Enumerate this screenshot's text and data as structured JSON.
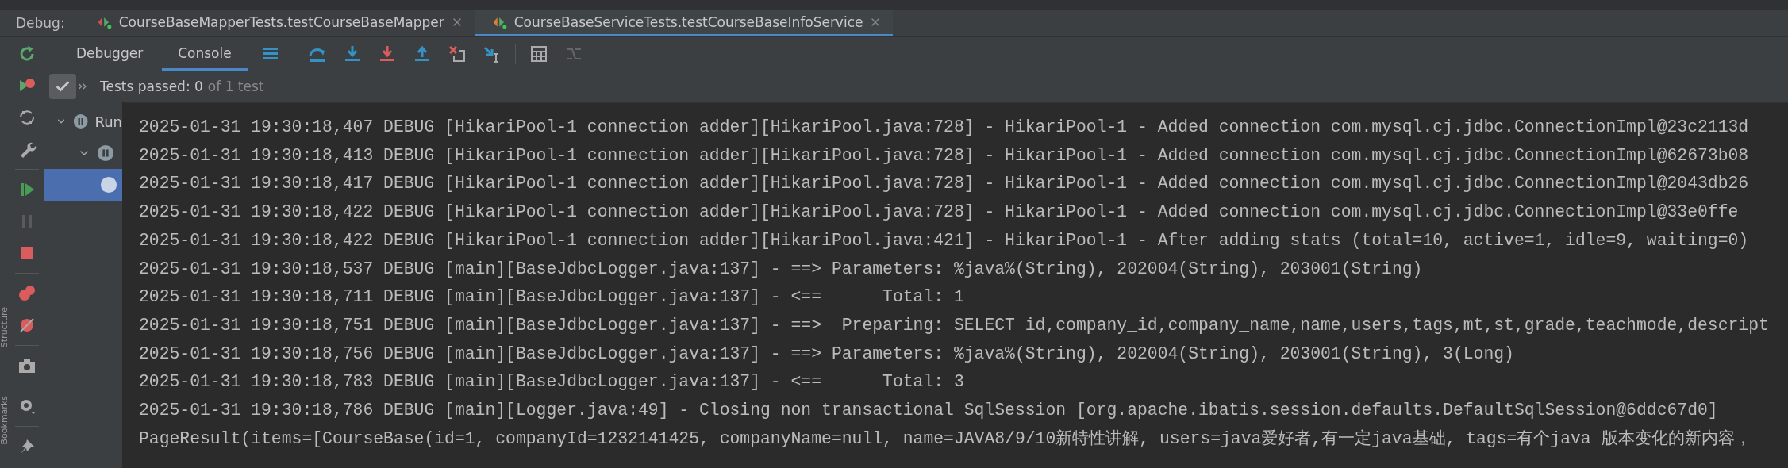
{
  "debug_label": "Debug:",
  "run_tabs": [
    {
      "label": "CourseBaseMapperTests.testCourseBaseMapper",
      "selected": false
    },
    {
      "label": "CourseBaseServiceTests.testCourseBaseInfoService",
      "selected": true
    }
  ],
  "view_tabs": [
    {
      "label": "Debugger",
      "selected": false
    },
    {
      "label": "Console",
      "selected": true
    }
  ],
  "tests_status": {
    "show_passed": true,
    "passed": "Tests passed: 0",
    "total": "of 1 test"
  },
  "side_labels": [
    "Structure",
    "Bookmarks"
  ],
  "tree": [
    {
      "label": "Run",
      "expanded": true,
      "selected": false,
      "children": [
        {
          "expanded": true,
          "selected": false,
          "children": [
            {
              "selected": true
            }
          ]
        }
      ]
    }
  ],
  "log_lines": [
    "2025-01-31 19:30:18,407 DEBUG [HikariPool-1 connection adder][HikariPool.java:728] - HikariPool-1 - Added connection com.mysql.cj.jdbc.ConnectionImpl@23c2113d",
    "2025-01-31 19:30:18,413 DEBUG [HikariPool-1 connection adder][HikariPool.java:728] - HikariPool-1 - Added connection com.mysql.cj.jdbc.ConnectionImpl@62673b08",
    "2025-01-31 19:30:18,417 DEBUG [HikariPool-1 connection adder][HikariPool.java:728] - HikariPool-1 - Added connection com.mysql.cj.jdbc.ConnectionImpl@2043db26",
    "2025-01-31 19:30:18,422 DEBUG [HikariPool-1 connection adder][HikariPool.java:728] - HikariPool-1 - Added connection com.mysql.cj.jdbc.ConnectionImpl@33e0ffe",
    "2025-01-31 19:30:18,422 DEBUG [HikariPool-1 connection adder][HikariPool.java:421] - HikariPool-1 - After adding stats (total=10, active=1, idle=9, waiting=0)",
    "2025-01-31 19:30:18,537 DEBUG [main][BaseJdbcLogger.java:137] - ==> Parameters: %java%(String), 202004(String), 203001(String)",
    "2025-01-31 19:30:18,711 DEBUG [main][BaseJdbcLogger.java:137] - <==      Total: 1",
    "2025-01-31 19:30:18,751 DEBUG [main][BaseJdbcLogger.java:137] - ==>  Preparing: SELECT id,company_id,company_name,name,users,tags,mt,st,grade,teachmode,descript",
    "2025-01-31 19:30:18,756 DEBUG [main][BaseJdbcLogger.java:137] - ==> Parameters: %java%(String), 202004(String), 203001(String), 3(Long)",
    "2025-01-31 19:30:18,783 DEBUG [main][BaseJdbcLogger.java:137] - <==      Total: 3",
    "2025-01-31 19:30:18,786 DEBUG [main][Logger.java:49] - Closing non transactional SqlSession [org.apache.ibatis.session.defaults.DefaultSqlSession@6ddc67d0]",
    "PageResult(items=[CourseBase(id=1, companyId=1232141425, companyName=null, name=JAVA8/9/10新特性讲解, users=java爱好者,有一定java基础, tags=有个java 版本变化的新内容，"
  ]
}
